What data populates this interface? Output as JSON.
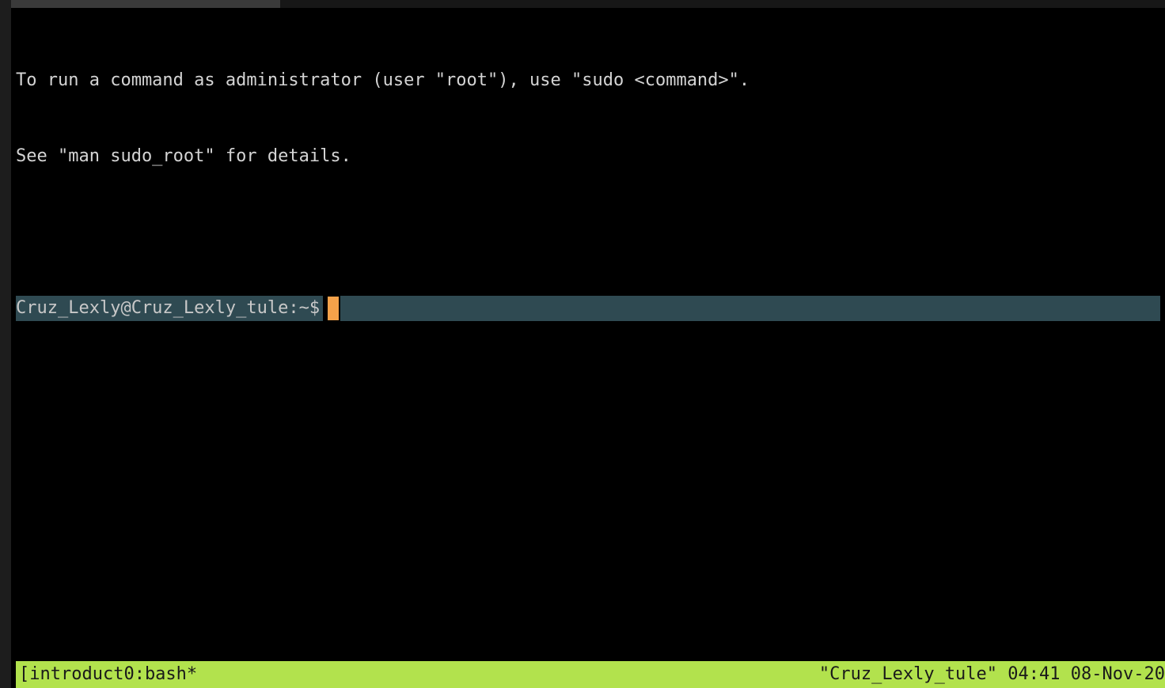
{
  "motd": {
    "line1": "To run a command as administrator (user \"root\"), use \"sudo <command>\".",
    "line2": "See \"man sudo_root\" for details."
  },
  "prompt": {
    "text": "Cruz_Lexly@Cruz_Lexly_tule:~$"
  },
  "status": {
    "left": "[introduct0:bash*",
    "right_host": "\"Cruz_Lexly_tule\"",
    "right_time": "04:41",
    "right_date": "08-Nov-20"
  }
}
